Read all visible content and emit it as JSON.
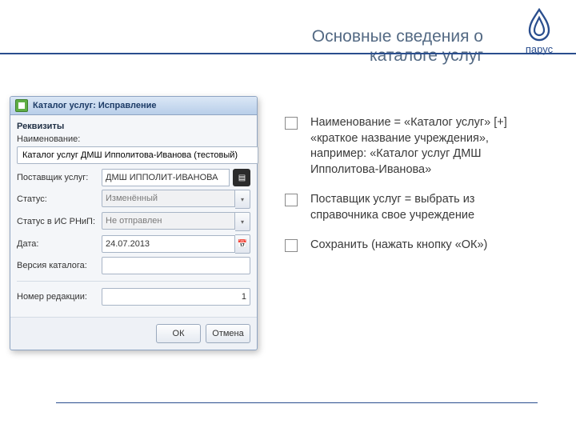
{
  "slide": {
    "title": "Основные сведения о каталоге услуг",
    "brand": "парус"
  },
  "dialog": {
    "title": "Каталог услуг: Исправление",
    "group": "Реквизиты",
    "labels": {
      "name": "Наименование:",
      "provider": "Поставщик услуг:",
      "status": "Статус:",
      "rnip": "Статус в ИС РНиП:",
      "date": "Дата:",
      "version": "Версия каталога:",
      "revision": "Номер редакции:"
    },
    "values": {
      "name": "Каталог услуг ДМШ Ипполитова-Иванова (тестовый)",
      "provider": "ДМШ ИППОЛИТ-ИВАНОВА",
      "status": "Изменённый",
      "rnip": "Не отправлен",
      "date": "24.07.2013",
      "version": "",
      "revision": "1"
    },
    "buttons": {
      "ok": "ОК",
      "cancel": "Отмена"
    }
  },
  "notes": {
    "n1": "Наименование = «Каталог услуг» [+] «краткое название учреждения», например: «Каталог услуг ДМШ Ипполитова-Иванова»",
    "n2": "Поставщик услуг = выбрать из справочника свое учреждение",
    "n3": "Сохранить (нажать кнопку «ОК»)"
  }
}
